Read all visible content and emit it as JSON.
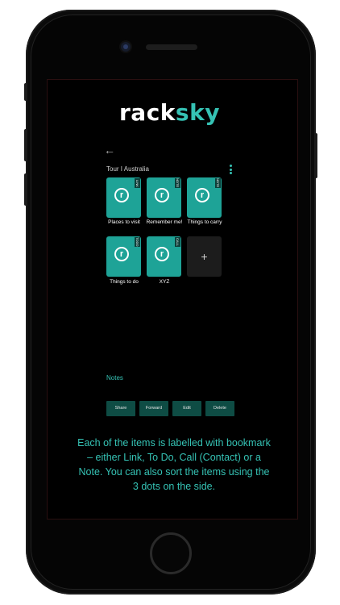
{
  "app": {
    "logo_part1": "rack",
    "logo_part2": "sky",
    "back_icon": "arrow-left-icon",
    "collection_title": "Tour I Australia",
    "more_menu_icon": "vertical-dots-icon"
  },
  "items": [
    {
      "caption": "Places to visit",
      "tag": "LINK"
    },
    {
      "caption": "Remember me!",
      "tag": "NOTE"
    },
    {
      "caption": "Things to carry",
      "tag": "NOTE"
    },
    {
      "caption": "Things to do",
      "tag": "TODO"
    },
    {
      "caption": "XYZ",
      "tag": "CALL"
    }
  ],
  "add_button": {
    "label": "+"
  },
  "notes": {
    "label": "Notes"
  },
  "actions": [
    "Share",
    "Forward",
    "Edit",
    "Delete"
  ],
  "description": "Each of the items is labelled with bookmark – either Link, To Do, Call (Contact) or a Note. You can also sort the items using the 3 dots on the side.",
  "colors": {
    "accent": "#35c2b4",
    "tile": "#1ea397",
    "button": "#0e4c44",
    "screen": "#000000"
  }
}
